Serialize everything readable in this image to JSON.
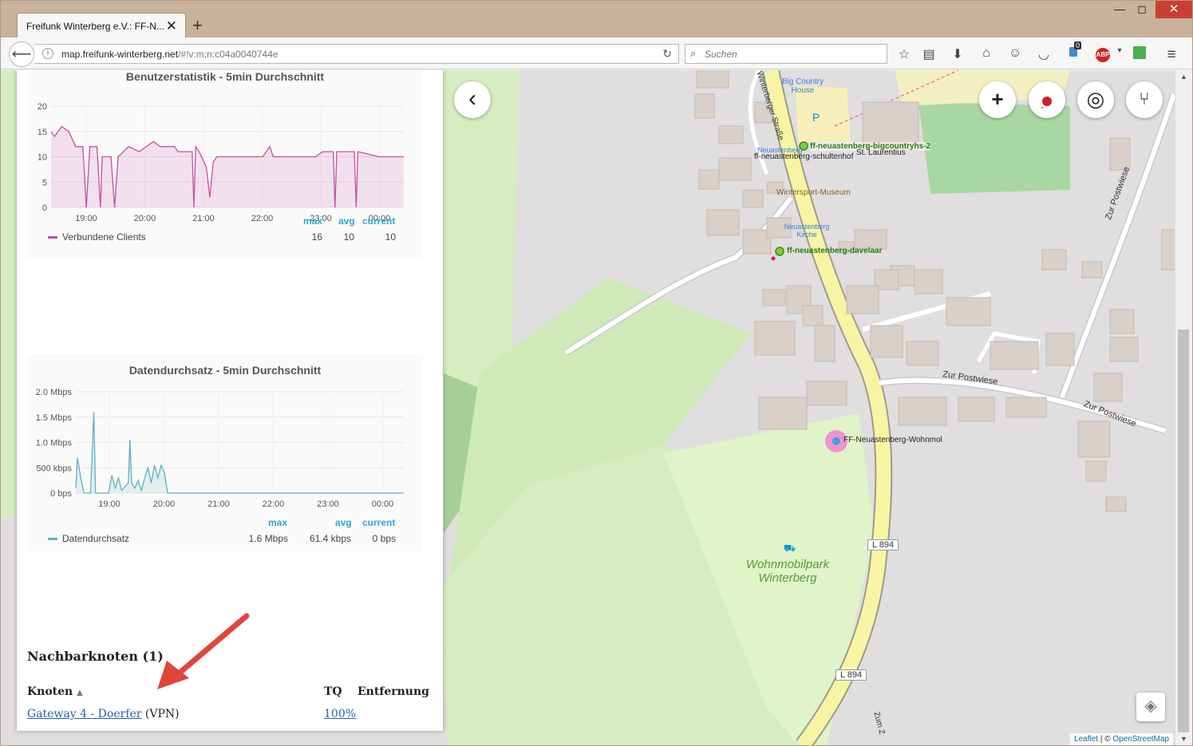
{
  "browser": {
    "tab_title": "Freifunk Winterberg e.V.: FF-N...",
    "tab_close": "✕",
    "new_tab": "+",
    "url_domain": "map.freifunk-winterberg.net",
    "url_prefix_hidden": "",
    "url_path": "/#!v:m;n:c04a0040744e",
    "search_placeholder": "Suchen",
    "badge_count": "0",
    "abp_label": "ABP"
  },
  "sidebar": {
    "chart1": {
      "title": "Benutzerstatistik - 5min Durchschnitt",
      "legend_headers": [
        "max",
        "avg",
        "current"
      ],
      "series_name": "Verbundene Clients",
      "max": "16",
      "avg": "10",
      "current": "10"
    },
    "chart2": {
      "title": "Datendurchsatz - 5min Durchschnitt",
      "legend_headers": [
        "max",
        "avg",
        "current"
      ],
      "series_name": "Datendurchsatz",
      "max": "1.6 Mbps",
      "avg": "61.4 kbps",
      "current": "0 bps"
    },
    "neighbours": {
      "heading": "Nachbarknoten (1)",
      "col_node": "Knoten",
      "col_tq": "TQ",
      "col_distance": "Entfernung",
      "rows": [
        {
          "node": "Gateway 4 - Doerfer",
          "suffix": "(VPN)",
          "tq": "100%",
          "distance": ""
        }
      ]
    }
  },
  "map": {
    "labels": {
      "big_country_house": "Big Country House",
      "parking": "P",
      "node1": "ff-neuastenberg-bigcountryhs-2",
      "node2": "ff-neuastenberg-schultenhof",
      "st_laurentius": "St. Laurentius",
      "stop1": "Neuastenberg",
      "museum": "Wintersport-Museum",
      "stop2_a": "Neuastenberg",
      "stop2_b": "Kirche",
      "node3": "ff-neuastenberg-davelaar",
      "node4": "FF-Neuastenberg-Wohnmol",
      "zur_postwiese_1": "Zur Postwiese",
      "zur_postwiese_2": "Zur Postwiese",
      "zur_postwiese_3": "Zur Postwiese",
      "park_a": "Wohnmobilpark",
      "park_b": "Winterberg",
      "road1": "L 894",
      "road2": "L 894",
      "street": "Winterberger Straße",
      "zum": "Zum Z"
    },
    "attribution_leaflet": "Leaflet",
    "attribution_sep": " | © ",
    "attribution_osm": "OpenStreetMap",
    "buttons": {
      "back": "‹",
      "zoom_in": "+",
      "locate": "◎"
    }
  },
  "chart_data": [
    {
      "type": "area",
      "title": "Benutzerstatistik - 5min Durchschnitt",
      "xlabel": "",
      "ylabel": "",
      "x_ticks": [
        "19:00",
        "20:00",
        "21:00",
        "22:00",
        "23:00",
        "00:00"
      ],
      "y_ticks": [
        "0",
        "5",
        "10",
        "15",
        "20"
      ],
      "ylim": [
        0,
        20
      ],
      "color": "#c64fa0",
      "series": [
        {
          "name": "Verbundene Clients",
          "points": [
            [
              0,
              15
            ],
            [
              0.01,
              14
            ],
            [
              0.03,
              16
            ],
            [
              0.05,
              15
            ],
            [
              0.07,
              12
            ],
            [
              0.09,
              12
            ],
            [
              0.1,
              0
            ],
            [
              0.11,
              12
            ],
            [
              0.13,
              12
            ],
            [
              0.14,
              0
            ],
            [
              0.145,
              10
            ],
            [
              0.17,
              10
            ],
            [
              0.18,
              0
            ],
            [
              0.19,
              10
            ],
            [
              0.22,
              12
            ],
            [
              0.25,
              11
            ],
            [
              0.27,
              12
            ],
            [
              0.29,
              13
            ],
            [
              0.31,
              12
            ],
            [
              0.33,
              12
            ],
            [
              0.35,
              12
            ],
            [
              0.36,
              11
            ],
            [
              0.4,
              11
            ],
            [
              0.405,
              0
            ],
            [
              0.41,
              12
            ],
            [
              0.42,
              11
            ],
            [
              0.44,
              8
            ],
            [
              0.45,
              2
            ],
            [
              0.46,
              9
            ],
            [
              0.47,
              10
            ],
            [
              0.48,
              10
            ],
            [
              0.49,
              10
            ],
            [
              0.5,
              10
            ],
            [
              0.6,
              10
            ],
            [
              0.61,
              11
            ],
            [
              0.62,
              12
            ],
            [
              0.63,
              10
            ],
            [
              0.75,
              10
            ],
            [
              0.77,
              11
            ],
            [
              0.8,
              11
            ],
            [
              0.805,
              0
            ],
            [
              0.81,
              11
            ],
            [
              0.86,
              11
            ],
            [
              0.865,
              0
            ],
            [
              0.87,
              11
            ],
            [
              0.93,
              10
            ],
            [
              1,
              10
            ]
          ]
        }
      ]
    },
    {
      "type": "area",
      "title": "Datendurchsatz - 5min Durchschnitt",
      "xlabel": "",
      "ylabel": "",
      "x_ticks": [
        "19:00",
        "20:00",
        "21:00",
        "22:00",
        "23:00",
        "00:00"
      ],
      "y_ticks": [
        "0 bps",
        "500 kbps",
        "1.0 Mbps",
        "1.5 Mbps",
        "2.0 Mbps"
      ],
      "ylim": [
        0,
        2.0
      ],
      "color": "#5fb0c8",
      "series": [
        {
          "name": "Datendurchsatz",
          "points": [
            [
              0,
              0.1
            ],
            [
              0.005,
              0.7
            ],
            [
              0.015,
              0.3
            ],
            [
              0.025,
              0
            ],
            [
              0.045,
              0
            ],
            [
              0.055,
              1.6
            ],
            [
              0.06,
              0
            ],
            [
              0.1,
              0
            ],
            [
              0.11,
              0.35
            ],
            [
              0.12,
              0.1
            ],
            [
              0.13,
              0.3
            ],
            [
              0.14,
              0.05
            ],
            [
              0.16,
              0.2
            ],
            [
              0.165,
              1.05
            ],
            [
              0.17,
              0.2
            ],
            [
              0.18,
              0.1
            ],
            [
              0.19,
              0.25
            ],
            [
              0.2,
              0.05
            ],
            [
              0.21,
              0.3
            ],
            [
              0.22,
              0.5
            ],
            [
              0.23,
              0.2
            ],
            [
              0.24,
              0.55
            ],
            [
              0.25,
              0.3
            ],
            [
              0.26,
              0.55
            ],
            [
              0.27,
              0.4
            ],
            [
              0.28,
              0
            ],
            [
              1,
              0
            ]
          ]
        }
      ]
    }
  ]
}
